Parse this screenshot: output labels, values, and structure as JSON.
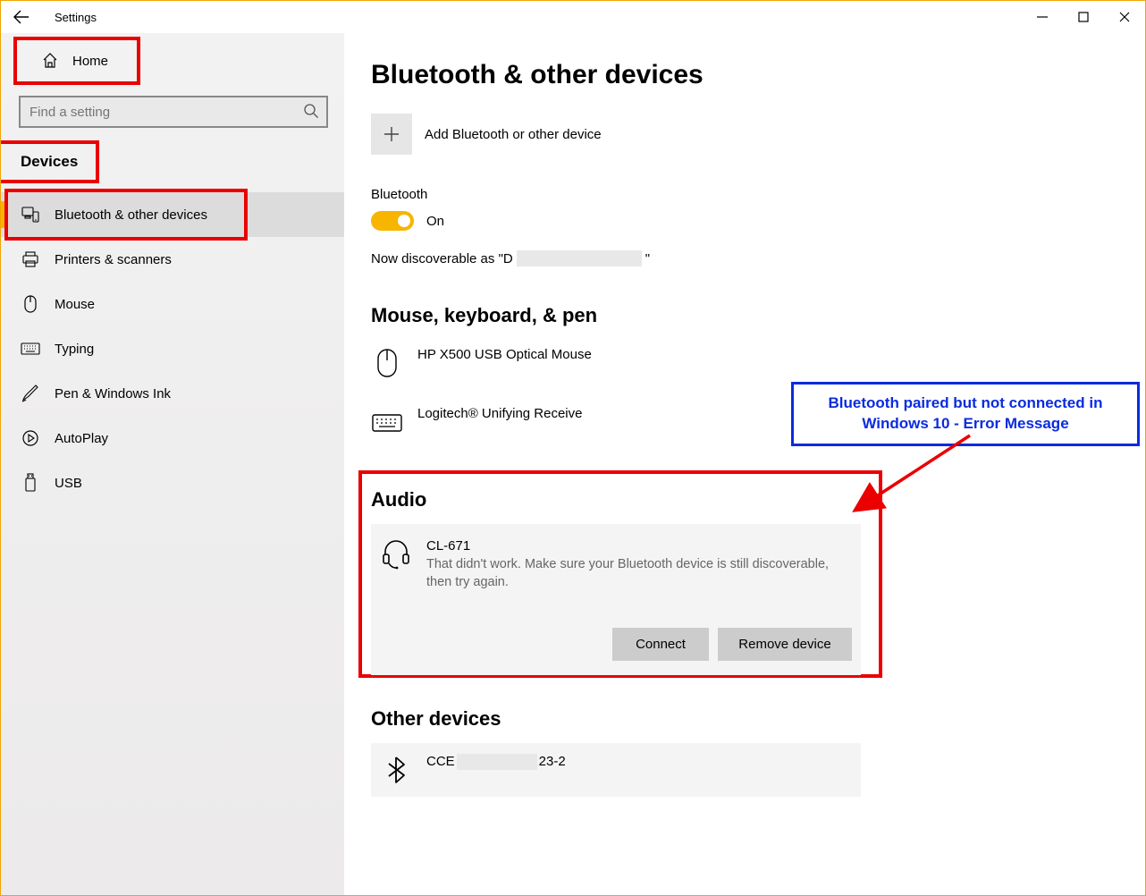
{
  "window": {
    "title": "Settings"
  },
  "sidebar": {
    "home": "Home",
    "search_placeholder": "Find a setting",
    "category": "Devices",
    "items": [
      {
        "label": "Bluetooth & other devices",
        "icon": "bluetooth-devices-icon"
      },
      {
        "label": "Printers & scanners",
        "icon": "printer-icon"
      },
      {
        "label": "Mouse",
        "icon": "mouse-icon"
      },
      {
        "label": "Typing",
        "icon": "keyboard-icon"
      },
      {
        "label": "Pen & Windows Ink",
        "icon": "pen-icon"
      },
      {
        "label": "AutoPlay",
        "icon": "autoplay-icon"
      },
      {
        "label": "USB",
        "icon": "usb-icon"
      }
    ]
  },
  "main": {
    "page_title": "Bluetooth & other devices",
    "add_device": "Add Bluetooth or other device",
    "bluetooth_label": "Bluetooth",
    "bluetooth_state": "On",
    "discoverable_prefix": "Now discoverable as \"D",
    "discoverable_suffix": "\"",
    "group_mouse": "Mouse, keyboard, & pen",
    "devices_mouse": [
      {
        "name": "HP X500 USB Optical Mouse"
      },
      {
        "name": "Logitech® Unifying Receive"
      }
    ],
    "group_audio": "Audio",
    "audio_device": {
      "name": "CL-671",
      "error": "That didn't work. Make sure your Bluetooth device is still discoverable, then try again.",
      "connect_btn": "Connect",
      "remove_btn": "Remove device"
    },
    "group_other": "Other devices",
    "other_devices": [
      {
        "prefix": "CCE",
        "suffix": "23-2"
      }
    ]
  },
  "annotation": {
    "text": "Bluetooth paired but not connected in Windows 10 - Error Message"
  }
}
